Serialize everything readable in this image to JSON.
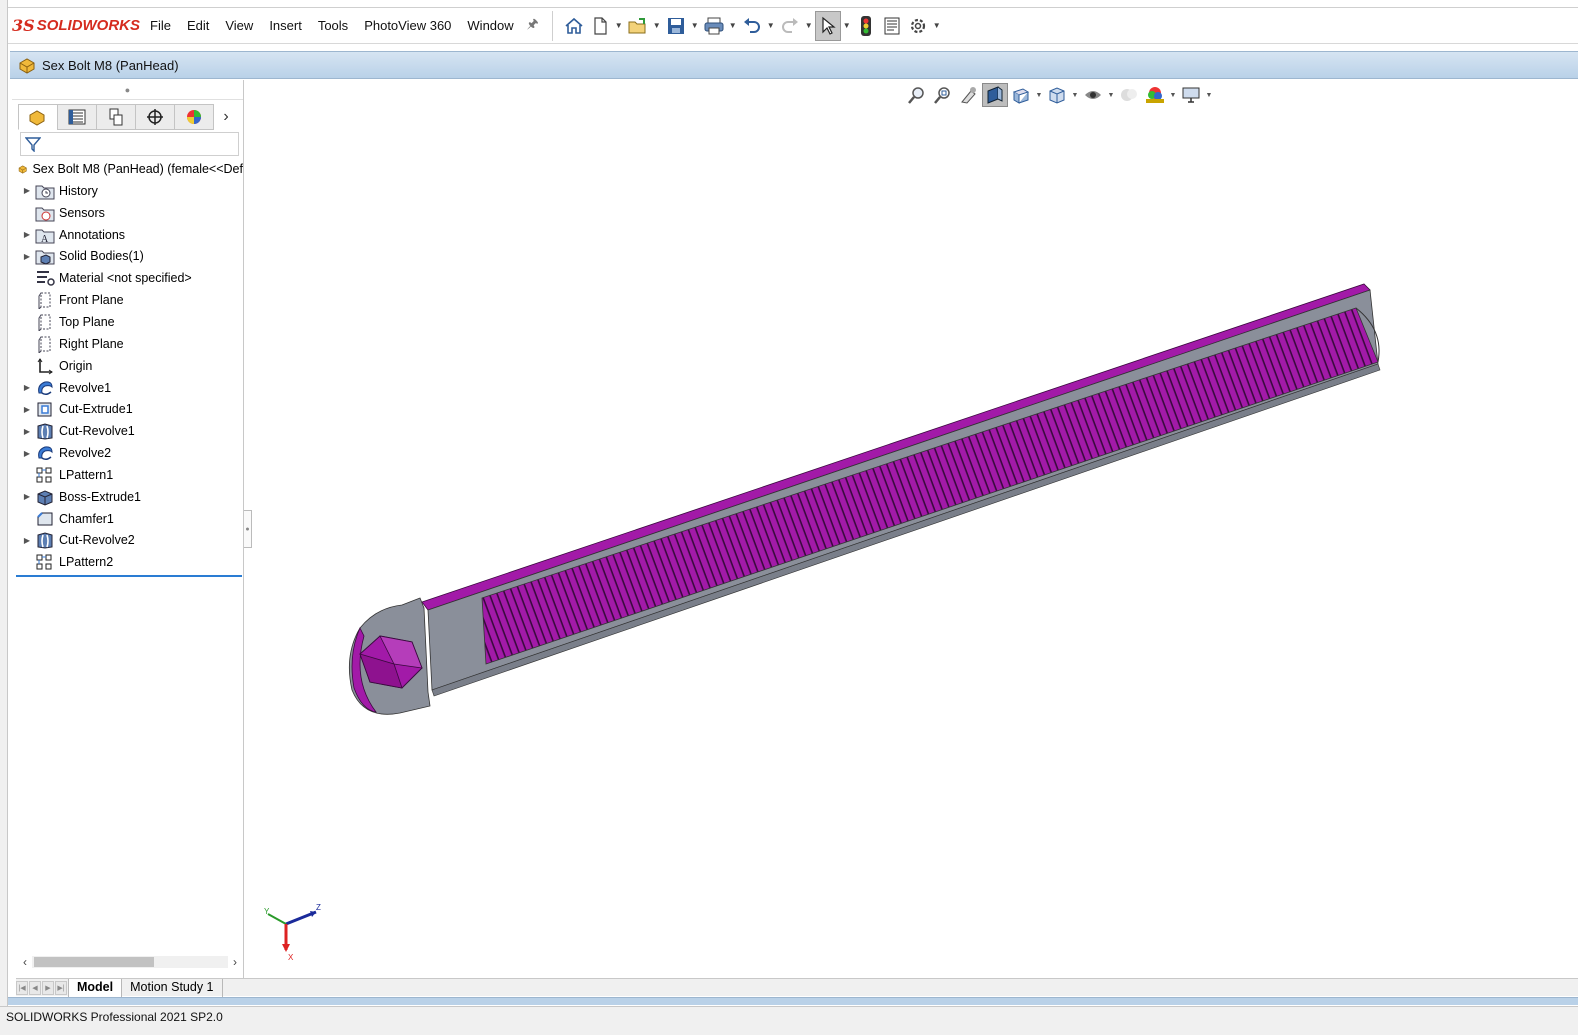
{
  "app": {
    "logo_prefix": "3S",
    "logo_text": "SOLIDWORKS"
  },
  "menu": {
    "items": [
      "File",
      "Edit",
      "View",
      "Insert",
      "Tools",
      "PhotoView 360",
      "Window"
    ]
  },
  "toolbar": {
    "icons": [
      "home-icon",
      "new-document-icon",
      "open-icon",
      "save-icon",
      "print-icon",
      "undo-icon",
      "redo-icon",
      "select-icon",
      "rebuild-icon",
      "file-properties-icon",
      "options-icon"
    ]
  },
  "document": {
    "title": "Sex Bolt M8 (PanHead)"
  },
  "feature_manager": {
    "root_label": "Sex Bolt M8 (PanHead)  (female<<Def",
    "items": [
      {
        "label": "History",
        "icon": "history-folder-icon",
        "expandable": true
      },
      {
        "label": "Sensors",
        "icon": "sensors-icon",
        "expandable": false
      },
      {
        "label": "Annotations",
        "icon": "annotations-icon",
        "expandable": true
      },
      {
        "label": "Solid Bodies(1)",
        "icon": "solid-bodies-icon",
        "expandable": true
      },
      {
        "label": "Material <not specified>",
        "icon": "material-icon",
        "expandable": false
      },
      {
        "label": "Front Plane",
        "icon": "plane-icon",
        "expandable": false
      },
      {
        "label": "Top Plane",
        "icon": "plane-icon",
        "expandable": false
      },
      {
        "label": "Right Plane",
        "icon": "plane-icon",
        "expandable": false
      },
      {
        "label": "Origin",
        "icon": "origin-icon",
        "expandable": false
      },
      {
        "label": "Revolve1",
        "icon": "revolve-icon",
        "expandable": true
      },
      {
        "label": "Cut-Extrude1",
        "icon": "cut-extrude-icon",
        "expandable": true
      },
      {
        "label": "Cut-Revolve1",
        "icon": "cut-revolve-icon",
        "expandable": true
      },
      {
        "label": "Revolve2",
        "icon": "revolve-icon",
        "expandable": true
      },
      {
        "label": "LPattern1",
        "icon": "linear-pattern-icon",
        "expandable": false
      },
      {
        "label": "Boss-Extrude1",
        "icon": "boss-extrude-icon",
        "expandable": true
      },
      {
        "label": "Chamfer1",
        "icon": "chamfer-icon",
        "expandable": false
      },
      {
        "label": "Cut-Revolve2",
        "icon": "cut-revolve-icon",
        "expandable": true
      },
      {
        "label": "LPattern2",
        "icon": "linear-pattern-icon",
        "expandable": false
      }
    ]
  },
  "bottom_tabs": {
    "model": "Model",
    "motion_study": "Motion Study 1"
  },
  "status": {
    "text": "SOLIDWORKS Professional 2021 SP2.0"
  },
  "triad": {
    "x": "X",
    "y": "Y",
    "z": "Z"
  },
  "colors": {
    "model_face": "#a21aa8",
    "model_section": "#8a8f9a",
    "brand_red": "#d52b1e",
    "selection_blue": "#2a7cd3"
  }
}
